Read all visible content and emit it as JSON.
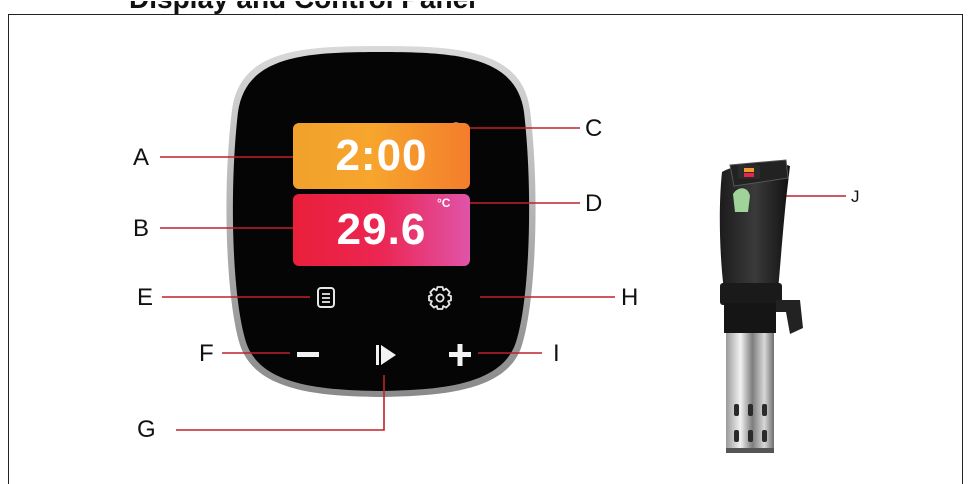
{
  "heading": "Display and Control Panel",
  "display": {
    "time": "2:00",
    "temperature": "29.6",
    "unit": "°C"
  },
  "callouts": {
    "a": "A",
    "b": "B",
    "c": "C",
    "d": "D",
    "e": "E",
    "f": "F",
    "g": "G",
    "h": "H",
    "i": "I",
    "j": "J"
  },
  "icons": {
    "menu": "menu-icon",
    "settings": "gear-icon",
    "minus": "minus-icon",
    "play": "play-icon",
    "plus": "plus-icon",
    "wifi": "wifi-icon"
  },
  "colors": {
    "leader_line": "#c0202a",
    "panel": "#050505",
    "time_display": "#f39a2c",
    "temp_display": "#e8254c"
  }
}
